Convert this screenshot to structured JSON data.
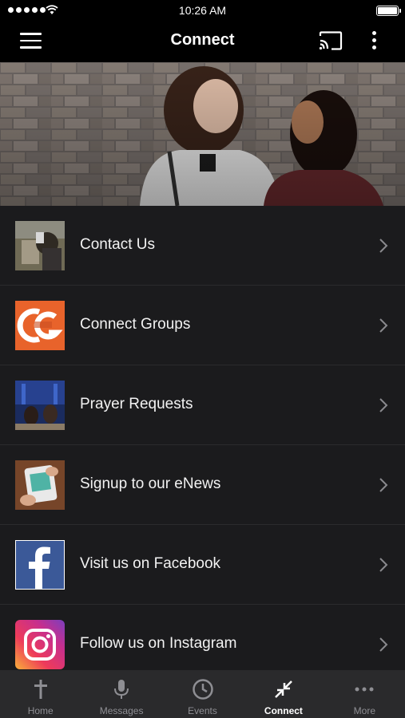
{
  "status_bar": {
    "time": "10:26 AM"
  },
  "nav": {
    "title": "Connect"
  },
  "menu_items": [
    {
      "label": "Contact Us",
      "icon": "contact-thumbnail"
    },
    {
      "label": "Connect Groups",
      "icon": "connect-groups-logo"
    },
    {
      "label": "Prayer Requests",
      "icon": "prayer-thumbnail"
    },
    {
      "label": "Signup to our eNews",
      "icon": "enews-thumbnail"
    },
    {
      "label": "Visit us on Facebook",
      "icon": "facebook-logo"
    },
    {
      "label": "Follow us on Instagram",
      "icon": "instagram-logo"
    }
  ],
  "tabs": [
    {
      "label": "Home",
      "icon": "cross-icon",
      "active": false
    },
    {
      "label": "Messages",
      "icon": "microphone-icon",
      "active": false
    },
    {
      "label": "Events",
      "icon": "clock-icon",
      "active": false
    },
    {
      "label": "Connect",
      "icon": "collapse-arrows-icon",
      "active": true
    },
    {
      "label": "More",
      "icon": "ellipsis-icon",
      "active": false
    }
  ],
  "colors": {
    "background": "#000000",
    "list_background": "#1b1b1d",
    "tab_bar": "#2a2a2c",
    "tab_inactive": "#8e8e93",
    "facebook_blue": "#3b5998",
    "groups_orange": "#e8632b"
  }
}
